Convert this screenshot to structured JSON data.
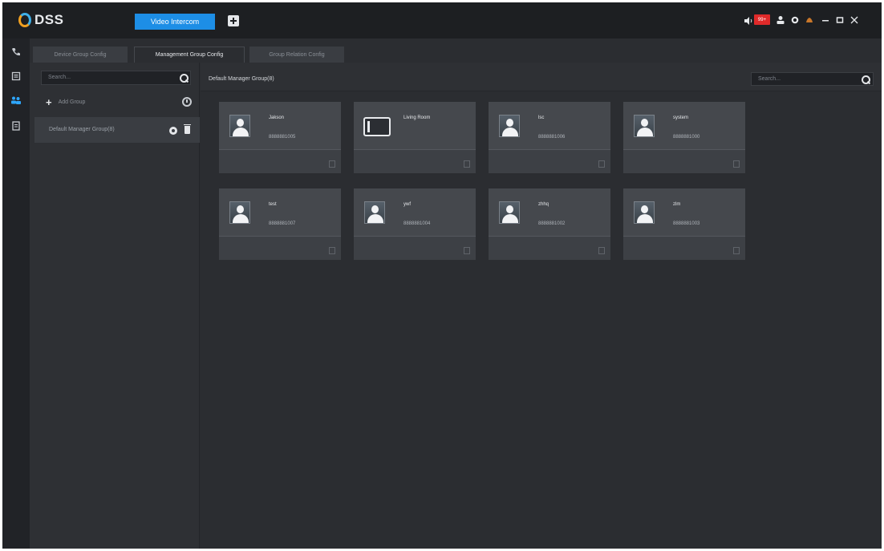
{
  "app": {
    "logo_text": "DSS",
    "active_module": "Video Intercom",
    "alarm_badge": "99+"
  },
  "subtabs": [
    "Device Group Config",
    "Management Group Config",
    "Group Relation Config"
  ],
  "left_panel": {
    "search_placeholder": "Search...",
    "add_group_label": "Add Group",
    "groups": [
      "Default Manager Group(8)"
    ]
  },
  "main": {
    "group_title": "Default Manager Group(8)",
    "search_placeholder": "Search...",
    "cards": [
      {
        "name": "Jakson",
        "number": "8888881005",
        "type": "user"
      },
      {
        "name": "Living Room",
        "number": "",
        "type": "device"
      },
      {
        "name": "lsc",
        "number": "8888881006",
        "type": "user"
      },
      {
        "name": "system",
        "number": "8888881000",
        "type": "user"
      },
      {
        "name": "test",
        "number": "8888881007",
        "type": "user"
      },
      {
        "name": "ywf",
        "number": "8888881004",
        "type": "user"
      },
      {
        "name": "zhhq",
        "number": "8888881002",
        "type": "user"
      },
      {
        "name": "zlm",
        "number": "8888881003",
        "type": "user"
      }
    ]
  },
  "icons": {
    "rail": [
      "phone-icon",
      "monitor-icon",
      "users-icon",
      "document-icon"
    ],
    "window": [
      "speaker-icon",
      "user-icon",
      "settings-icon",
      "minimize-icon",
      "restore-icon",
      "close-icon"
    ]
  },
  "colors": {
    "accent": "#1d8ee6",
    "alarm": "#e02a2a",
    "rail_active": "#2ea7ff"
  }
}
